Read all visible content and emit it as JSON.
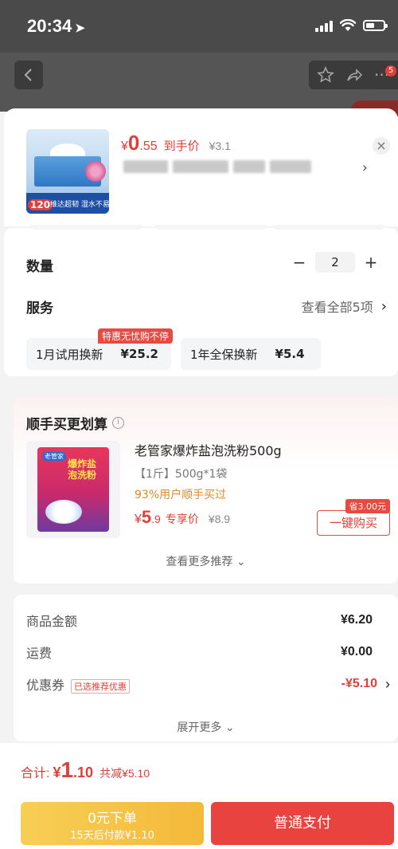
{
  "status_bar": {
    "time": "20:34",
    "location_arrow": "➤"
  },
  "header": {
    "badge": "5"
  },
  "product": {
    "currency": "¥",
    "price_int": "0",
    "price_dec": ".55",
    "price_tag": "到手价",
    "original_price": "¥3.1",
    "thumb_count": "120",
    "thumb_tagline": "维达超韧 湿水不易破",
    "close_glyph": "×",
    "chevron": "›"
  },
  "options": {
    "quantity_label": "数量",
    "quantity": "2",
    "minus": "−",
    "plus": "+",
    "service_label": "服务",
    "service_all": "查看全部5项",
    "services": [
      {
        "name": "1月试用换新",
        "price": "¥25.2"
      },
      {
        "name": "1年全保换新",
        "price": "¥5.4"
      }
    ],
    "service_badge": "特惠无忧购不停"
  },
  "upsell": {
    "title": "顺手买更划算",
    "info_glyph": "i",
    "product_name": "老管家爆炸盐泡洗粉500g",
    "spec": "【1斤】500g*1袋",
    "stat": "93%用户顺手买过",
    "currency": "¥",
    "price_int": "5",
    "price_dec": ".9",
    "price_tag": "专享价",
    "original_price": "¥8.9",
    "save_badge": "省3.00元",
    "buy_button": "一键购买",
    "more": "查看更多推荐 ⌄",
    "bag_title": "爆炸盐\n泡洗粉",
    "bag_brand": "老管家"
  },
  "summary": {
    "rows": [
      {
        "label": "商品金额",
        "value": "¥6.20"
      },
      {
        "label": "运费",
        "value": "¥0.00"
      }
    ],
    "coupon_label": "优惠券",
    "coupon_tag": "已选推荐优惠",
    "coupon_value": "-¥5.10",
    "expand": "展开更多 ⌄"
  },
  "footer": {
    "total_label": "合计:",
    "currency": "¥",
    "total_int": "1",
    "total_dec": ".10",
    "total_saved": "共减¥5.10",
    "later_button_line1": "0元下单",
    "later_button_line2": "15天后付款¥1.10",
    "pay_button": "普通支付"
  },
  "colors": {
    "accent": "#e0403a",
    "pay_button": "#e8433f",
    "later_button": "#f4b93a"
  }
}
